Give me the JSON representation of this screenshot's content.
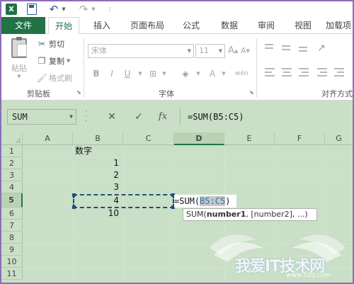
{
  "app": {
    "logo": "X",
    "icons": [
      "excel-logo-icon",
      "save-icon",
      "undo-icon",
      "redo-icon"
    ]
  },
  "tabs": [
    "文件",
    "开始",
    "插入",
    "页面布局",
    "公式",
    "数据",
    "审阅",
    "视图",
    "加载项"
  ],
  "active_tab": "开始",
  "ribbon": {
    "clipboard": {
      "paste": "粘贴",
      "cut": "剪切",
      "copy": "复制",
      "format_painter": "格式刷",
      "group_label": "剪贴板"
    },
    "font": {
      "font_name": "宋体",
      "font_size": "11",
      "bold": "B",
      "italic": "I",
      "underline": "U",
      "group_label": "字体"
    },
    "alignment": {
      "group_label": "对齐方式"
    }
  },
  "formula_bar": {
    "name_box": "SUM",
    "formula": "=SUM(B5:C5)",
    "cancel": "✕",
    "enter": "✓",
    "fx": "fx"
  },
  "grid": {
    "columns": [
      "A",
      "B",
      "C",
      "D",
      "E",
      "F",
      "G"
    ],
    "active_column": "D",
    "rows": [
      "1",
      "2",
      "3",
      "4",
      "5",
      "6",
      "7",
      "8",
      "9",
      "10",
      "11"
    ],
    "active_row": "5",
    "cells": {
      "B1": "数字",
      "B2": "1",
      "B3": "2",
      "B4": "3",
      "B5": "4",
      "B6": "10"
    },
    "editing_cell": {
      "prefix": "=SUM(",
      "ref": "B5:C5",
      "suffix": ")"
    },
    "tooltip": {
      "func": "SUM(",
      "arg1": "number1",
      "rest": ", [number2], ...)"
    }
  },
  "watermark": {
    "text": "我爱IT技术网",
    "url": "www.52ij.com"
  }
}
